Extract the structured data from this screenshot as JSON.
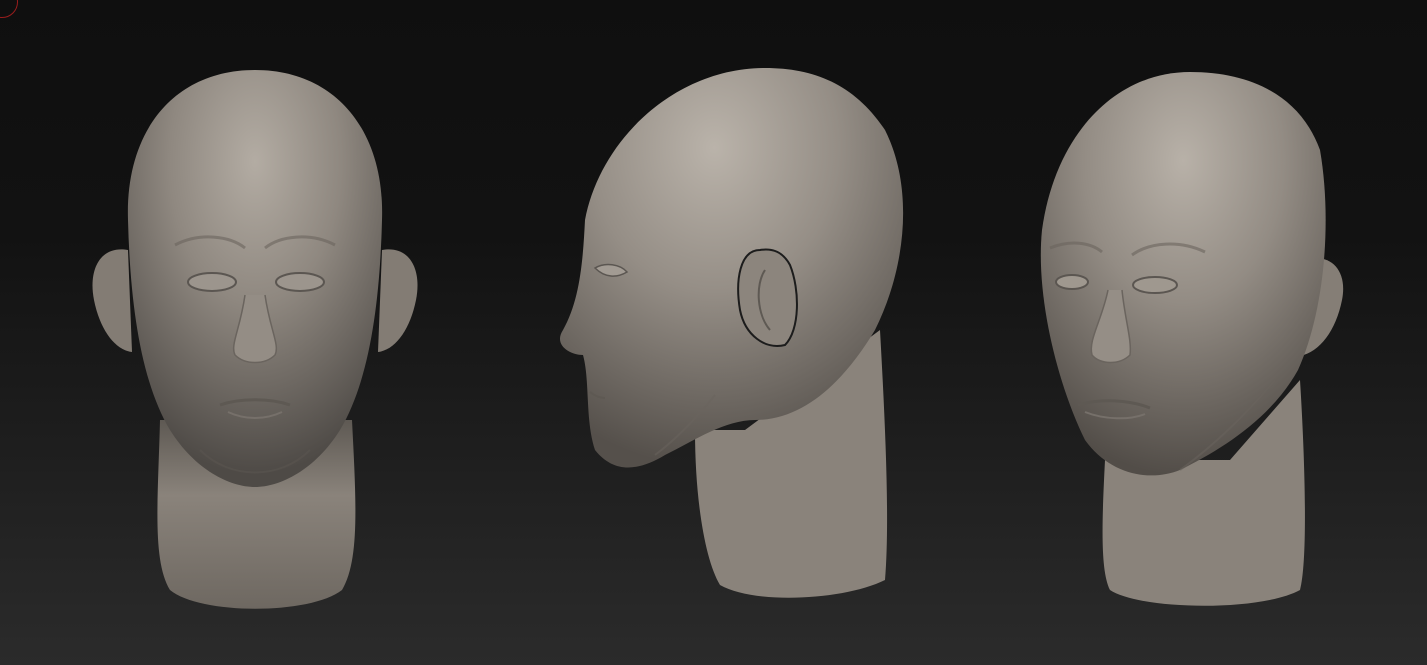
{
  "viewport": {
    "background_top": "#0f0f0f",
    "background_bottom": "#2b2b2b"
  },
  "corner_indicator": {
    "icon": "rotation-circle-icon",
    "color": "#9a1d1d"
  },
  "models": [
    {
      "view": "front",
      "material_color": "#8f8880"
    },
    {
      "view": "side",
      "material_color": "#8f8880"
    },
    {
      "view": "three-quarter",
      "material_color": "#8f8880"
    }
  ]
}
